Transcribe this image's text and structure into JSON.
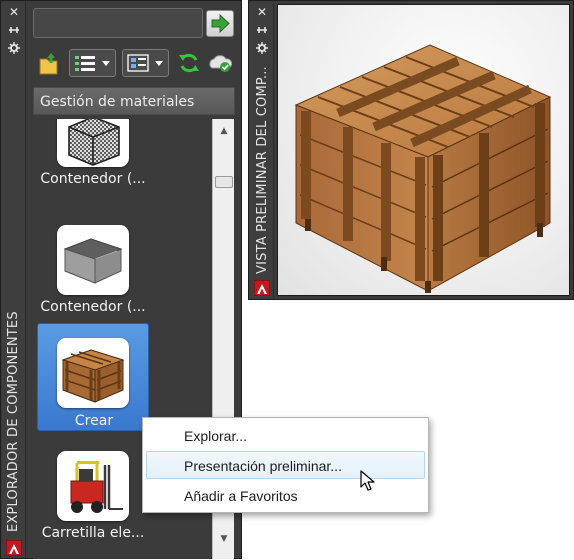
{
  "explorer": {
    "title": "EXPLORADOR DE COMPONENTES",
    "search": {
      "value": "",
      "placeholder": ""
    },
    "header": "Gestión de materiales",
    "items": [
      {
        "label": "Contenedor (...",
        "icon": "wire-cage-container-icon"
      },
      {
        "label": "Contenedor (...",
        "icon": "grey-bin-container-icon"
      },
      {
        "label": "Crear",
        "icon": "wooden-crate-icon",
        "selected": true
      },
      {
        "label": "Carretilla ele...",
        "icon": "forklift-icon"
      }
    ]
  },
  "preview": {
    "title": "VISTA PRELIMINAR DEL COMP..."
  },
  "context_menu": {
    "items": [
      {
        "label": "Explorar..."
      },
      {
        "label": "Presentación preliminar...",
        "highlighted": true
      },
      {
        "label": "Añadir a Favoritos"
      }
    ]
  },
  "colors": {
    "palette_bg": "#3b3b3b",
    "selection": "#4a8ad9",
    "menu_highlight": "#e4f0fa",
    "go_arrow": "#3aa13a",
    "wood": "#b8783f"
  }
}
